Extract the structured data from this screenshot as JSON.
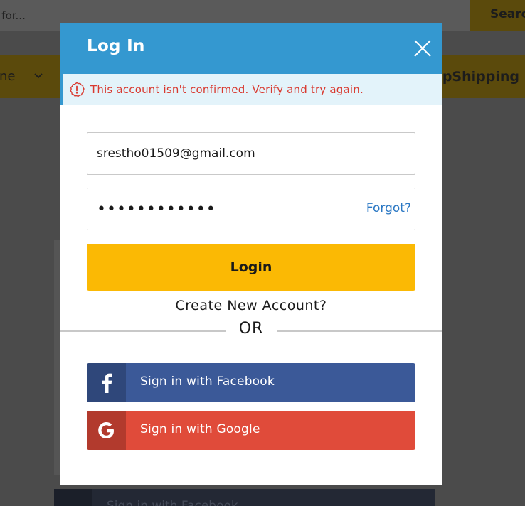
{
  "background": {
    "search_placeholder": "g for...",
    "search_button": "Search",
    "nav_phone": "one",
    "nav_shipping": "opShipping",
    "facebook_label": "Sign in with Facebook"
  },
  "modal": {
    "title": "Log In",
    "alert_message": "This account isn't confirmed. Verify and try again.",
    "email_value": "srestho01509@gmail.com",
    "password_value": "••••••••••••",
    "forgot_label": "Forgot?",
    "login_label": "Login",
    "create_account_label": "Create New Account?",
    "or_label": "OR",
    "facebook_label": "Sign in with Facebook",
    "google_label": "Sign in with Google"
  },
  "icons": {
    "close": "close-icon",
    "alert": "alert-circle-icon",
    "facebook": "facebook-icon",
    "google": "google-icon",
    "chevron": "chevron-down-icon"
  },
  "colors": {
    "header": "#3498d0",
    "login_button": "#fbb904",
    "facebook": "#3b5998",
    "google": "#e04b3a",
    "alert_text": "#d9392f",
    "link": "#2b78c4"
  }
}
